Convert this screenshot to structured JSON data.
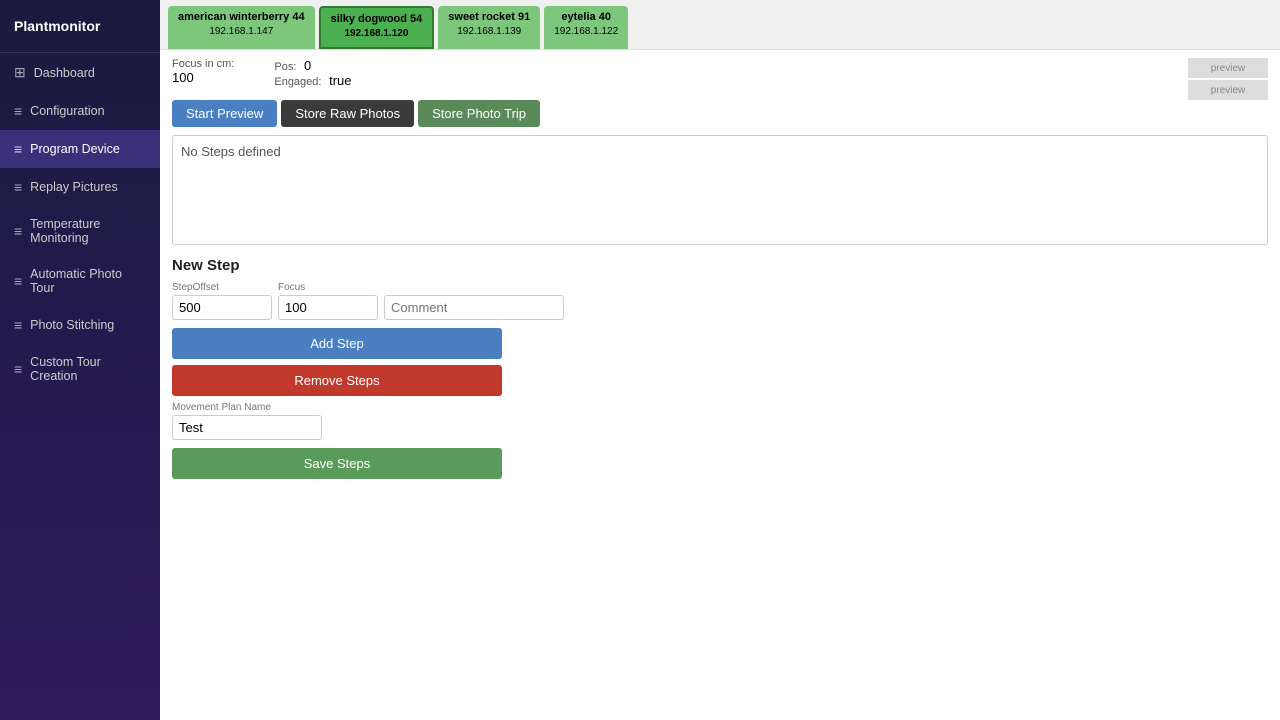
{
  "app": {
    "name": "Plantmonitor"
  },
  "sidebar": {
    "items": [
      {
        "id": "dashboard",
        "label": "Dashboard",
        "icon": "⊞",
        "active": false
      },
      {
        "id": "configuration",
        "label": "Configuration",
        "icon": "≡",
        "active": false
      },
      {
        "id": "program-device",
        "label": "Program Device",
        "icon": "≡",
        "active": true
      },
      {
        "id": "replay-pictures",
        "label": "Replay Pictures",
        "icon": "≡",
        "active": false
      },
      {
        "id": "temperature-monitoring",
        "label": "Temperature Monitoring",
        "icon": "≡",
        "active": false
      },
      {
        "id": "automatic-photo-tour",
        "label": "Automatic Photo Tour",
        "icon": "≡",
        "active": false
      },
      {
        "id": "photo-stitching",
        "label": "Photo Stitching",
        "icon": "≡",
        "active": false
      },
      {
        "id": "custom-tour-creation",
        "label": "Custom Tour Creation",
        "icon": "≡",
        "active": false
      }
    ]
  },
  "plant_tabs": [
    {
      "id": "plant1",
      "name": "american winterberry 44",
      "ip": "192.168.1.147",
      "style": "green"
    },
    {
      "id": "plant2",
      "name": "silky dogwood 54",
      "ip": "192.168.1.120",
      "style": "green-bold"
    },
    {
      "id": "plant3",
      "name": "sweet rocket 91",
      "ip": "192.168.1.139",
      "style": "green"
    },
    {
      "id": "plant4",
      "name": "eytelia 40",
      "ip": "192.168.1.122",
      "style": "green"
    }
  ],
  "info": {
    "focus_label": "Focus in cm:",
    "focus_value": "100",
    "pos_label": "Pos:",
    "pos_value": "0",
    "engaged_label": "Engaged:",
    "engaged_value": "true"
  },
  "buttons": {
    "start_preview": "Start Preview",
    "store_raw_photos": "Store Raw Photos",
    "store_photo_trip": "Store Photo Trip"
  },
  "steps_area": {
    "no_steps_text": "No Steps defined"
  },
  "new_step": {
    "title": "New Step",
    "step_offset_label": "StepOffset",
    "step_offset_value": "500",
    "focus_label": "Focus",
    "focus_value": "100",
    "comment_placeholder": "Comment",
    "add_step_label": "Add Step",
    "remove_steps_label": "Remove Steps",
    "movement_plan_name_label": "Movement Plan Name",
    "movement_plan_name_value": "Test",
    "save_steps_label": "Save Steps"
  }
}
